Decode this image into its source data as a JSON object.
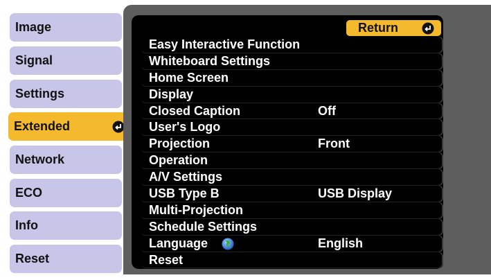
{
  "sidebar": {
    "items": [
      {
        "label": "Image"
      },
      {
        "label": "Signal"
      },
      {
        "label": "Settings"
      },
      {
        "label": "Extended"
      },
      {
        "label": "Network"
      },
      {
        "label": "ECO"
      },
      {
        "label": "Info"
      },
      {
        "label": "Reset"
      }
    ],
    "active_index": 3
  },
  "return_button": {
    "label": "Return"
  },
  "menu": {
    "items": [
      {
        "label": "Easy Interactive Function",
        "value": ""
      },
      {
        "label": "Whiteboard Settings",
        "value": ""
      },
      {
        "label": "Home Screen",
        "value": ""
      },
      {
        "label": "Display",
        "value": ""
      },
      {
        "label": "Closed Caption",
        "value": "Off"
      },
      {
        "label": "User's Logo",
        "value": ""
      },
      {
        "label": "Projection",
        "value": "Front"
      },
      {
        "label": "Operation",
        "value": ""
      },
      {
        "label": "A/V Settings",
        "value": ""
      },
      {
        "label": "USB Type B",
        "value": "USB Display"
      },
      {
        "label": "Multi-Projection",
        "value": ""
      },
      {
        "label": "Schedule Settings",
        "value": ""
      },
      {
        "label": "Language",
        "value": "English",
        "icon": "globe-icon"
      },
      {
        "label": "Reset",
        "value": ""
      }
    ]
  },
  "colors": {
    "sidebar_item": "#c7c6e8",
    "active": "#f5b92e",
    "panel": "#5e5e5e",
    "menu_bg": "#000000"
  }
}
